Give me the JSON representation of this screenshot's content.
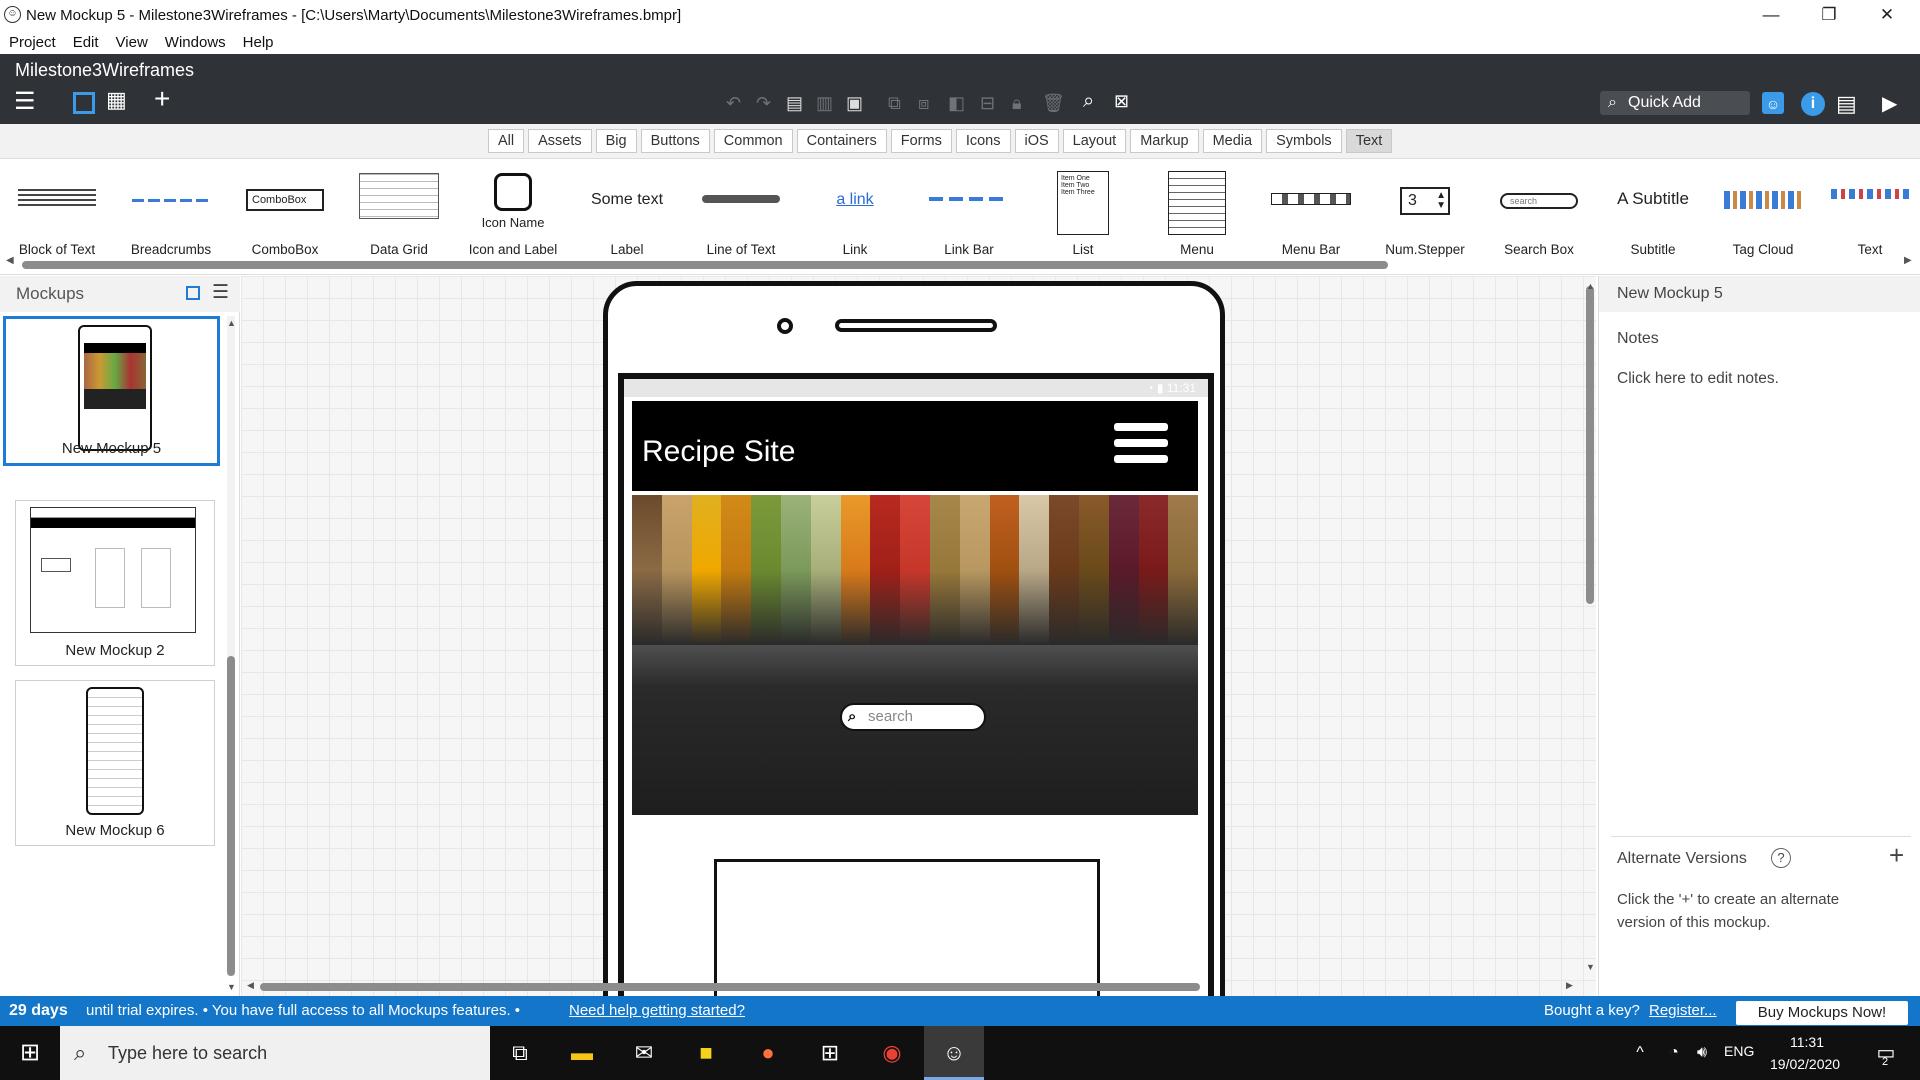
{
  "window": {
    "title": "New Mockup 5 - Milestone3Wireframes - [C:\\Users\\Marty\\Documents\\Milestone3Wireframes.bmpr]",
    "app_icon": "smiley-icon",
    "controls": [
      "minimize",
      "restore",
      "close"
    ]
  },
  "menubar": [
    "Project",
    "Edit",
    "View",
    "Windows",
    "Help"
  ],
  "toolbar": {
    "project_name": "Milestone3Wireframes",
    "quick_add_label": "Quick Add"
  },
  "filter_tabs": [
    {
      "label": "All",
      "active": false
    },
    {
      "label": "Assets",
      "active": false
    },
    {
      "label": "Big",
      "active": false
    },
    {
      "label": "Buttons",
      "active": false
    },
    {
      "label": "Common",
      "active": false
    },
    {
      "label": "Containers",
      "active": false
    },
    {
      "label": "Forms",
      "active": false
    },
    {
      "label": "Icons",
      "active": false
    },
    {
      "label": "iOS",
      "active": false
    },
    {
      "label": "Layout",
      "active": false
    },
    {
      "label": "Markup",
      "active": false
    },
    {
      "label": "Media",
      "active": false
    },
    {
      "label": "Symbols",
      "active": false
    },
    {
      "label": "Text",
      "active": true
    }
  ],
  "library": {
    "items": [
      "Block of Text",
      "Breadcrumbs",
      "ComboBox",
      "Data Grid",
      "Icon and Label",
      "Label",
      "Line of Text",
      "Link",
      "Link Bar",
      "List",
      "Menu",
      "Menu Bar",
      "Num.Stepper",
      "Search Box",
      "Subtitle",
      "Tag Cloud",
      "Text"
    ],
    "preview_texts": {
      "combobox": "ComboBox",
      "icon_name": "Icon Name",
      "some_text": "Some text",
      "link": "a link",
      "stepper_value": "3",
      "search": "search",
      "subtitle": "A Subtitle",
      "list_items": [
        "Item One",
        "Item Two",
        "Item Three"
      ]
    }
  },
  "mockups_panel": {
    "title": "Mockups",
    "items": [
      {
        "name": "New Mockup 5",
        "selected": true
      },
      {
        "name": "New Mockup 2",
        "selected": false
      },
      {
        "name": "New Mockup 6",
        "selected": false
      }
    ]
  },
  "canvas": {
    "status_time": "11:31",
    "site_title": "Recipe Site",
    "search_placeholder": "search"
  },
  "properties_panel": {
    "mockup_name": "New Mockup 5",
    "notes_label": "Notes",
    "notes_hint": "Click here to edit notes.",
    "alternate_label": "Alternate Versions",
    "alternate_help": "?",
    "alternate_hint": "Click the '+' to create an alternate version of this mockup."
  },
  "trial_bar": {
    "days": "29 days",
    "text": "until trial expires.  •  You have full access to all Mockups features.  •",
    "help_link": "Need help getting started?",
    "bought_text": "Bought a key?",
    "register_link": "Register...",
    "buy_button": "Buy Mockups Now!"
  },
  "taskbar": {
    "search_placeholder": "Type here to search",
    "language": "ENG",
    "time": "11:31",
    "date": "19/02/2020",
    "notification_count": "2"
  },
  "colors": {
    "accent": "#1376c8",
    "toolbar_bg": "#2f3236",
    "selection": "#1e7bd6"
  }
}
